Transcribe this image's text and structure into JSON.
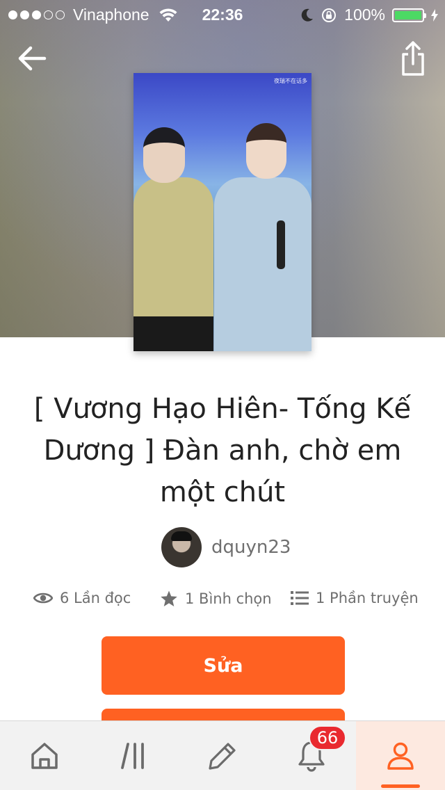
{
  "status_bar": {
    "carrier": "Vinaphone",
    "time": "22:36",
    "battery": "100%",
    "signal_bars_filled": 3,
    "signal_bars_total": 5,
    "battery_color": "#4cd964"
  },
  "header": {
    "back_icon": "arrow-left-icon",
    "share_icon": "share-icon"
  },
  "cover": {
    "caption": "夜瑞不在话多"
  },
  "story": {
    "title": "[ Vương Hạo Hiên- Tống Kế Dương ] Đàn anh, chờ em một chút",
    "author": "dquyn23"
  },
  "stats": {
    "reads": "6 Lần đọc",
    "votes": "1 Bình chọn",
    "parts": "1 Phần truyện"
  },
  "actions": {
    "edit_label": "Sửa",
    "accent_color": "#ff6122"
  },
  "tabbar": {
    "tabs": [
      {
        "name": "home",
        "icon": "home-icon"
      },
      {
        "name": "library",
        "icon": "library-icon"
      },
      {
        "name": "write",
        "icon": "pencil-icon"
      },
      {
        "name": "notifications",
        "icon": "bell-icon"
      },
      {
        "name": "profile",
        "icon": "user-icon",
        "active": true
      }
    ],
    "notification_count": "66"
  }
}
